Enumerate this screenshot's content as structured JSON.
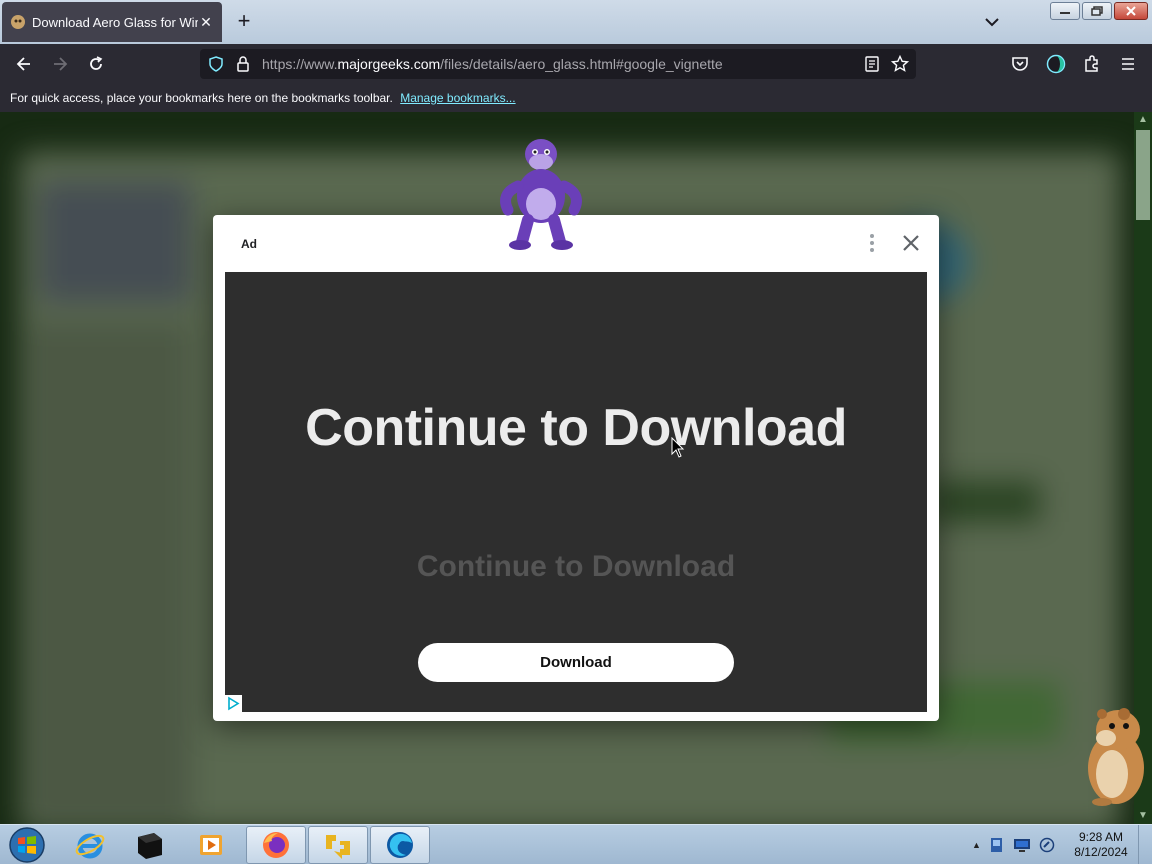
{
  "browser": {
    "tab": {
      "title": "Download Aero Glass for Windo",
      "close_glyph": "✕"
    },
    "new_tab_glyph": "+",
    "url": {
      "prefix": "https://www.",
      "host": "majorgeeks.com",
      "path": "/files/details/aero_glass.html#google_vignette"
    },
    "bookmarks_bar": {
      "message": "For quick access, place your bookmarks here on the bookmarks toolbar.",
      "link": "Manage bookmarks..."
    }
  },
  "ad": {
    "label": "Ad",
    "headline": "Continue to Download",
    "subline": "Continue to Download",
    "button": "Download",
    "creative_bg": "#2e2e2e"
  },
  "taskbar": {
    "time": "9:28 AM",
    "date": "8/12/2024"
  },
  "colors": {
    "firefox_chrome": "#2b2a33",
    "urlbar": "#1c1b22",
    "link": "#80ebff"
  }
}
